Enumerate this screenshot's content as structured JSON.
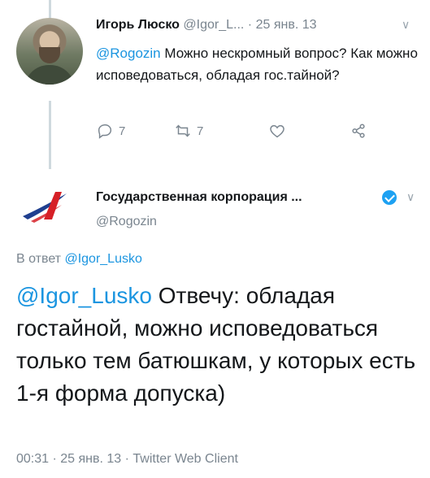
{
  "tweet1": {
    "author_name": "Игорь Люско",
    "author_handle": "@Igor_L...",
    "separator": "·",
    "date": "25 янв. 13",
    "mention": "@Rogozin",
    "text": "Можно нескромный вопрос? Как можно исповедоваться, обладая гос.тайной?",
    "reply_count": "7",
    "retweet_count": "7",
    "icons": [
      "reply-icon",
      "retweet-icon",
      "like-icon",
      "share-icon",
      "chevron-down-icon"
    ]
  },
  "tweet2": {
    "author_name": "Государственная корпорация ...",
    "author_handle": "@Rogozin",
    "reply_to_prefix": "В ответ",
    "reply_to_handle": "@Igor_Lusko",
    "mention": "@Igor_Lusko",
    "text": "Отвечу: обладая гостайной, можно исповедоваться только тем батюшкам, у которых есть 1-я форма допуска)",
    "meta": "00:31 · 25 янв. 13 · Twitter Web Client",
    "icons": [
      "roscosmos-logo-icon",
      "verified-badge-icon",
      "chevron-down-icon"
    ]
  },
  "colors": {
    "link": "#1b95e0",
    "muted": "#7a858f",
    "text": "#14171a",
    "verified": "#1da1f2",
    "logo_red": "#d62027",
    "logo_blue": "#1f3f8f"
  }
}
